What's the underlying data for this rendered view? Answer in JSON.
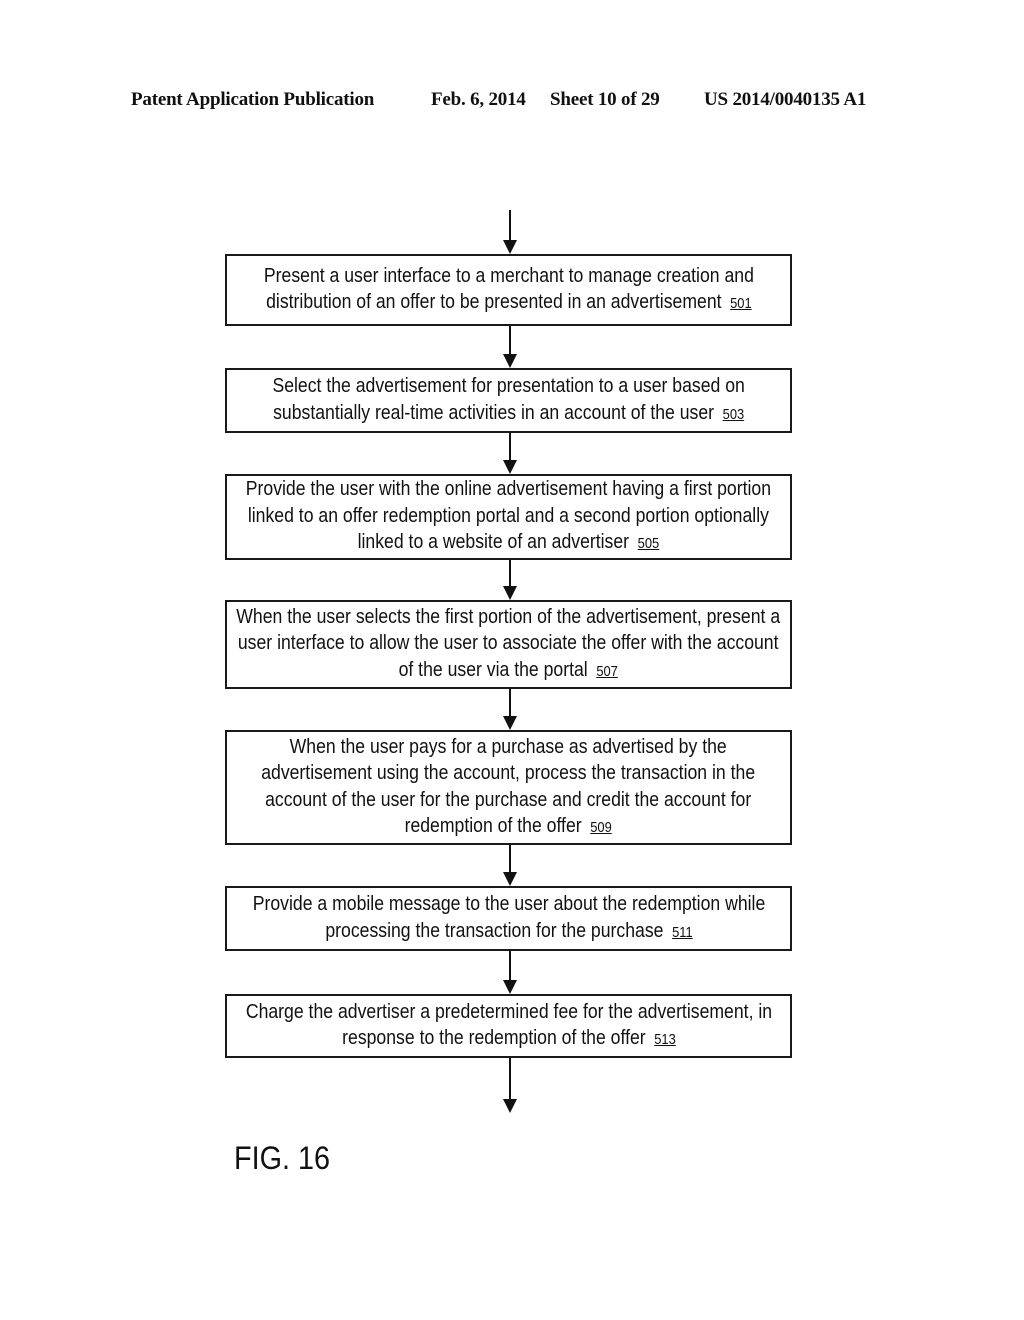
{
  "header": {
    "publication": "Patent Application Publication",
    "date": "Feb. 6, 2014",
    "sheet": "Sheet 10 of 29",
    "number": "US 2014/0040135 A1"
  },
  "steps": [
    {
      "lines": [
        "Present a user interface to a merchant to manage creation and",
        "distribution of an offer to be presented in an advertisement"
      ],
      "ref": "501"
    },
    {
      "lines": [
        "Select the advertisement for presentation to a user based on",
        "substantially real-time activities in an account of the user"
      ],
      "ref": "503"
    },
    {
      "lines": [
        "Provide the user with the online advertisement having a first portion",
        "linked to an offer redemption portal and a second portion optionally",
        "linked to a website of an advertiser"
      ],
      "ref": "505"
    },
    {
      "lines": [
        "When the user selects the first portion of the advertisement, present a",
        "user interface to allow the user to associate the offer with the account",
        "of the user via the portal"
      ],
      "ref": "507"
    },
    {
      "lines": [
        "When the user pays for a purchase as advertised by the",
        "advertisement using the account, process the transaction in the",
        "account of the user for the purchase and credit the account for",
        "redemption of the offer"
      ],
      "ref": "509"
    },
    {
      "lines": [
        "Provide a mobile message to the user about the redemption while",
        "processing the transaction for the purchase"
      ],
      "ref": "511"
    },
    {
      "lines": [
        "Charge the advertiser a predetermined fee for the advertisement, in",
        "response to the redemption of the offer"
      ],
      "ref": "513"
    }
  ],
  "figure_label": "FIG. 16"
}
